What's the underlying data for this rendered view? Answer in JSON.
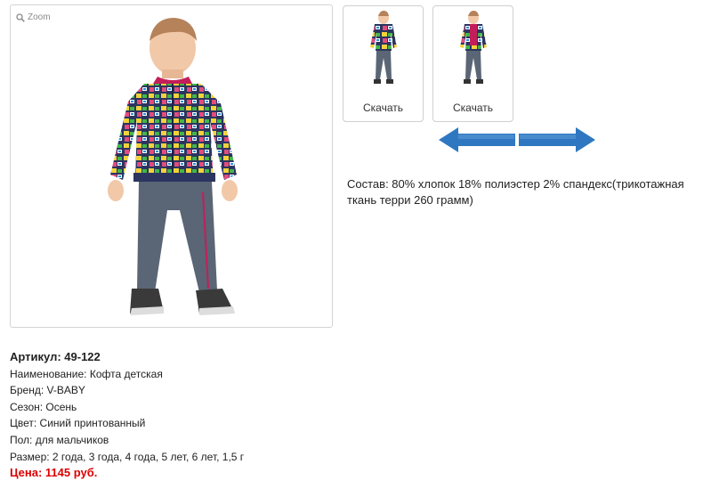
{
  "zoom": {
    "label": "Zoom",
    "icon": "magnifier-icon"
  },
  "thumbnails": [
    {
      "label": "Скачать"
    },
    {
      "label": "Скачать"
    }
  ],
  "navigation": {
    "prev_icon": "arrow-left-icon",
    "next_icon": "arrow-right-icon",
    "color": "#2f78c1"
  },
  "composition": "Состав: 80% хлопок 18% полиэстер 2% спандекс(трикотажная ткань терри 260 грамм)",
  "product": {
    "article": "Артикул: 49-122",
    "name": "Наименование: Кофта детская",
    "brand": "Бренд: V-BABY",
    "season": "Сезон: Осень",
    "color": "Цвет: Синий принтованный",
    "gender": "Пол: для мальчиков",
    "sizes": "Размер: 2 года, 3 года, 4 года, 5 лет, 6 лет, 1,5 г",
    "price": "Цена: 1145 руб."
  },
  "colors": {
    "price": "#dd0000",
    "jacket": "#2b3560",
    "pants": "#5a6575",
    "accent": "#c41e5a"
  }
}
